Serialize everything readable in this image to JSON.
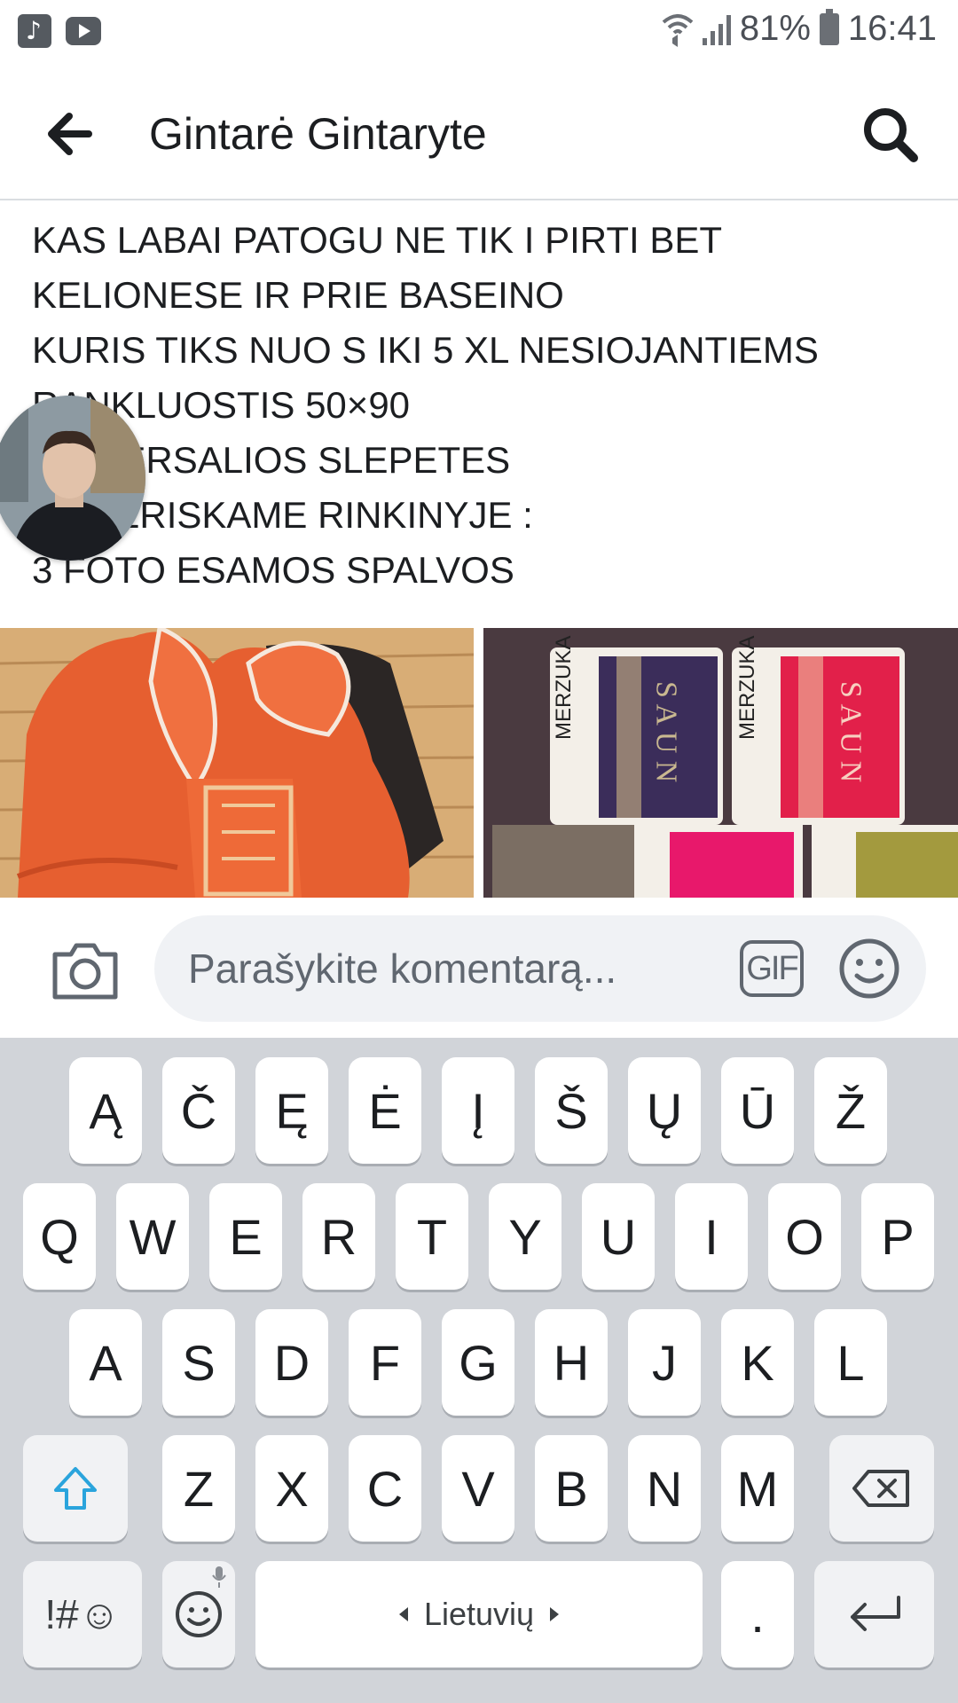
{
  "status_bar": {
    "battery": "81%",
    "time": "16:41",
    "icons": [
      "music-app-icon",
      "youtube-icon",
      "wifi-calling-icon",
      "signal-icon",
      "battery-charging-icon"
    ]
  },
  "header": {
    "title": "Gintarė Gintaryte",
    "back_icon": "arrow-left-icon",
    "search_icon": "search-icon"
  },
  "post": {
    "lines": [
      "KAS LABAI PATOGU NE TIK I PIRTI BET",
      "KELIONESE IR PRIE BASEINO",
      "KURIS TIKS NUO S IKI 5 XL NESIOJANTIEMS",
      "RANKLUOSTIS 50×90",
      "UNIVERSALIOS SLEPETES",
      "SIULERISKAME RINKINYJE :",
      "3 FOTO ESAMOS SPALVOS"
    ]
  },
  "photos": {
    "photo_2_labels": [
      "MERZUKA",
      "S A U N",
      "S A U N",
      "MERZUKA"
    ]
  },
  "composer": {
    "placeholder": "Parašykite komentarą...",
    "gif_label": "GIF",
    "camera_icon": "camera-icon",
    "emoji_icon": "emoji-icon"
  },
  "keyboard": {
    "row_lt": [
      "Ą",
      "Č",
      "Ę",
      "Ė",
      "Į",
      "Š",
      "Ų",
      "Ū",
      "Ž"
    ],
    "row1": [
      "Q",
      "W",
      "E",
      "R",
      "T",
      "Y",
      "U",
      "I",
      "O",
      "P"
    ],
    "row2": [
      "A",
      "S",
      "D",
      "F",
      "G",
      "H",
      "J",
      "K",
      "L"
    ],
    "row3": [
      "Z",
      "X",
      "C",
      "V",
      "B",
      "N",
      "M"
    ],
    "symbols_label": "!#☺",
    "space_label": "Lietuvių",
    "period_label": ".",
    "colors": {
      "shift_accent": "#2aa4dc",
      "key_bg": "#ffffff",
      "keyboard_bg": "#d1d4d9"
    }
  }
}
